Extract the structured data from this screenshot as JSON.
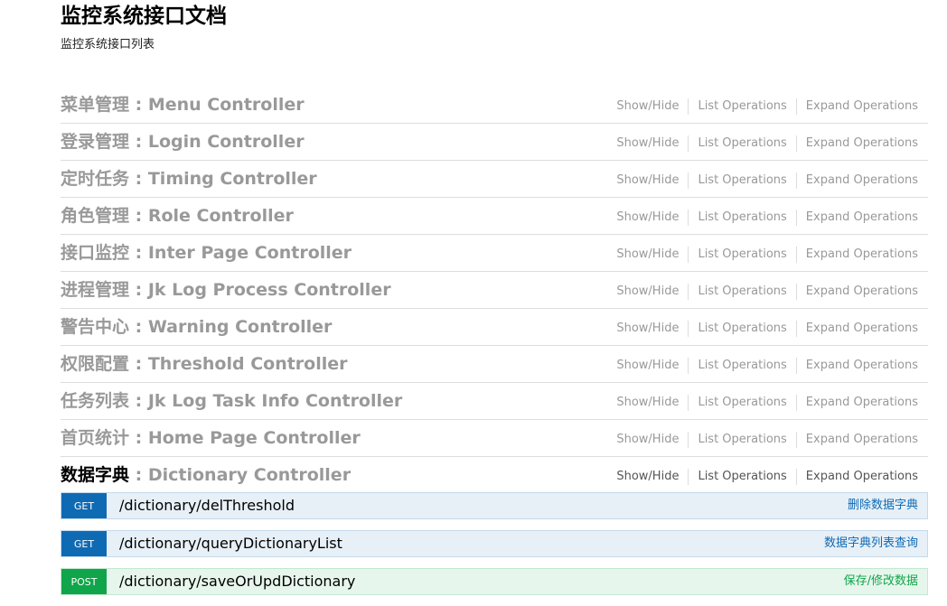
{
  "doc": {
    "title": "监控系统接口文档",
    "description": "监控系统接口列表"
  },
  "ops_labels": {
    "show_hide": "Show/Hide",
    "list_operations": "List Operations",
    "expand_operations": "Expand Operations"
  },
  "resources": [
    {
      "cn": "菜单管理",
      "sep": " : ",
      "en": "Menu Controller"
    },
    {
      "cn": "登录管理",
      "sep": " : ",
      "en": "Login Controller"
    },
    {
      "cn": "定时任务",
      "sep": " : ",
      "en": "Timing Controller"
    },
    {
      "cn": "角色管理",
      "sep": " : ",
      "en": "Role Controller"
    },
    {
      "cn": "接口监控",
      "sep": " : ",
      "en": "Inter Page Controller"
    },
    {
      "cn": "进程管理",
      "sep": " : ",
      "en": "Jk Log Process Controller"
    },
    {
      "cn": "警告中心",
      "sep": " : ",
      "en": "Warning Controller"
    },
    {
      "cn": "权限配置",
      "sep": " : ",
      "en": "Threshold Controller"
    },
    {
      "cn": "任务列表",
      "sep": " : ",
      "en": "Jk Log Task Info Controller"
    },
    {
      "cn": "首页统计",
      "sep": " : ",
      "en": "Home Page Controller"
    },
    {
      "cn": "数据字典",
      "sep": " : ",
      "en": "Dictionary Controller"
    }
  ],
  "endpoints": [
    {
      "method": "GET",
      "path": "/dictionary/delThreshold",
      "summary": "删除数据字典"
    },
    {
      "method": "GET",
      "path": "/dictionary/queryDictionaryList",
      "summary": "数据字典列表查询"
    },
    {
      "method": "POST",
      "path": "/dictionary/saveOrUpdDictionary",
      "summary": "保存/修改数据"
    }
  ],
  "colors": {
    "get": "#0f6ab4",
    "post": "#10a54a",
    "muted_heading": "#999999"
  }
}
